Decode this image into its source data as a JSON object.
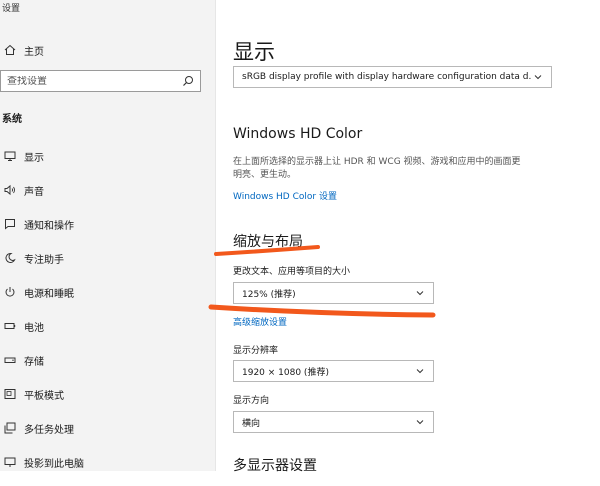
{
  "app": {
    "title": "设置"
  },
  "sidebar": {
    "home_label": "主页",
    "search_placeholder": "查找设置",
    "section": "系统",
    "items": [
      {
        "label": "显示",
        "icon": "monitor-icon"
      },
      {
        "label": "声音",
        "icon": "speaker-icon"
      },
      {
        "label": "通知和操作",
        "icon": "notification-icon"
      },
      {
        "label": "专注助手",
        "icon": "moon-icon"
      },
      {
        "label": "电源和睡眠",
        "icon": "power-icon"
      },
      {
        "label": "电池",
        "icon": "battery-icon"
      },
      {
        "label": "存储",
        "icon": "storage-icon"
      },
      {
        "label": "平板模式",
        "icon": "tablet-mode-icon"
      },
      {
        "label": "多任务处理",
        "icon": "multitask-icon"
      },
      {
        "label": "投影到此电脑",
        "icon": "project-icon"
      }
    ]
  },
  "main": {
    "title": "显示",
    "color_profile_value": "sRGB display profile with display hardware configuration data d...",
    "hdr": {
      "heading": "Windows HD Color",
      "description_line1": "在上面所选择的显示器上让 HDR 和 WCG 视频、游戏和应用中的画面更",
      "description_line2": "明亮、更生动。",
      "link": "Windows HD Color 设置"
    },
    "scale": {
      "heading": "缩放与布局",
      "size_label": "更改文本、应用等项目的大小",
      "size_value": "125% (推荐)",
      "advanced_link": "高级缩放设置",
      "resolution_label": "显示分辨率",
      "resolution_value": "1920 × 1080 (推荐)",
      "orientation_label": "显示方向",
      "orientation_value": "横向"
    },
    "multi_display_heading": "多显示器设置"
  },
  "colors": {
    "accent": "#0067c0",
    "annotation": "#f2581c",
    "sidebar_bg": "#f3f3f3"
  }
}
